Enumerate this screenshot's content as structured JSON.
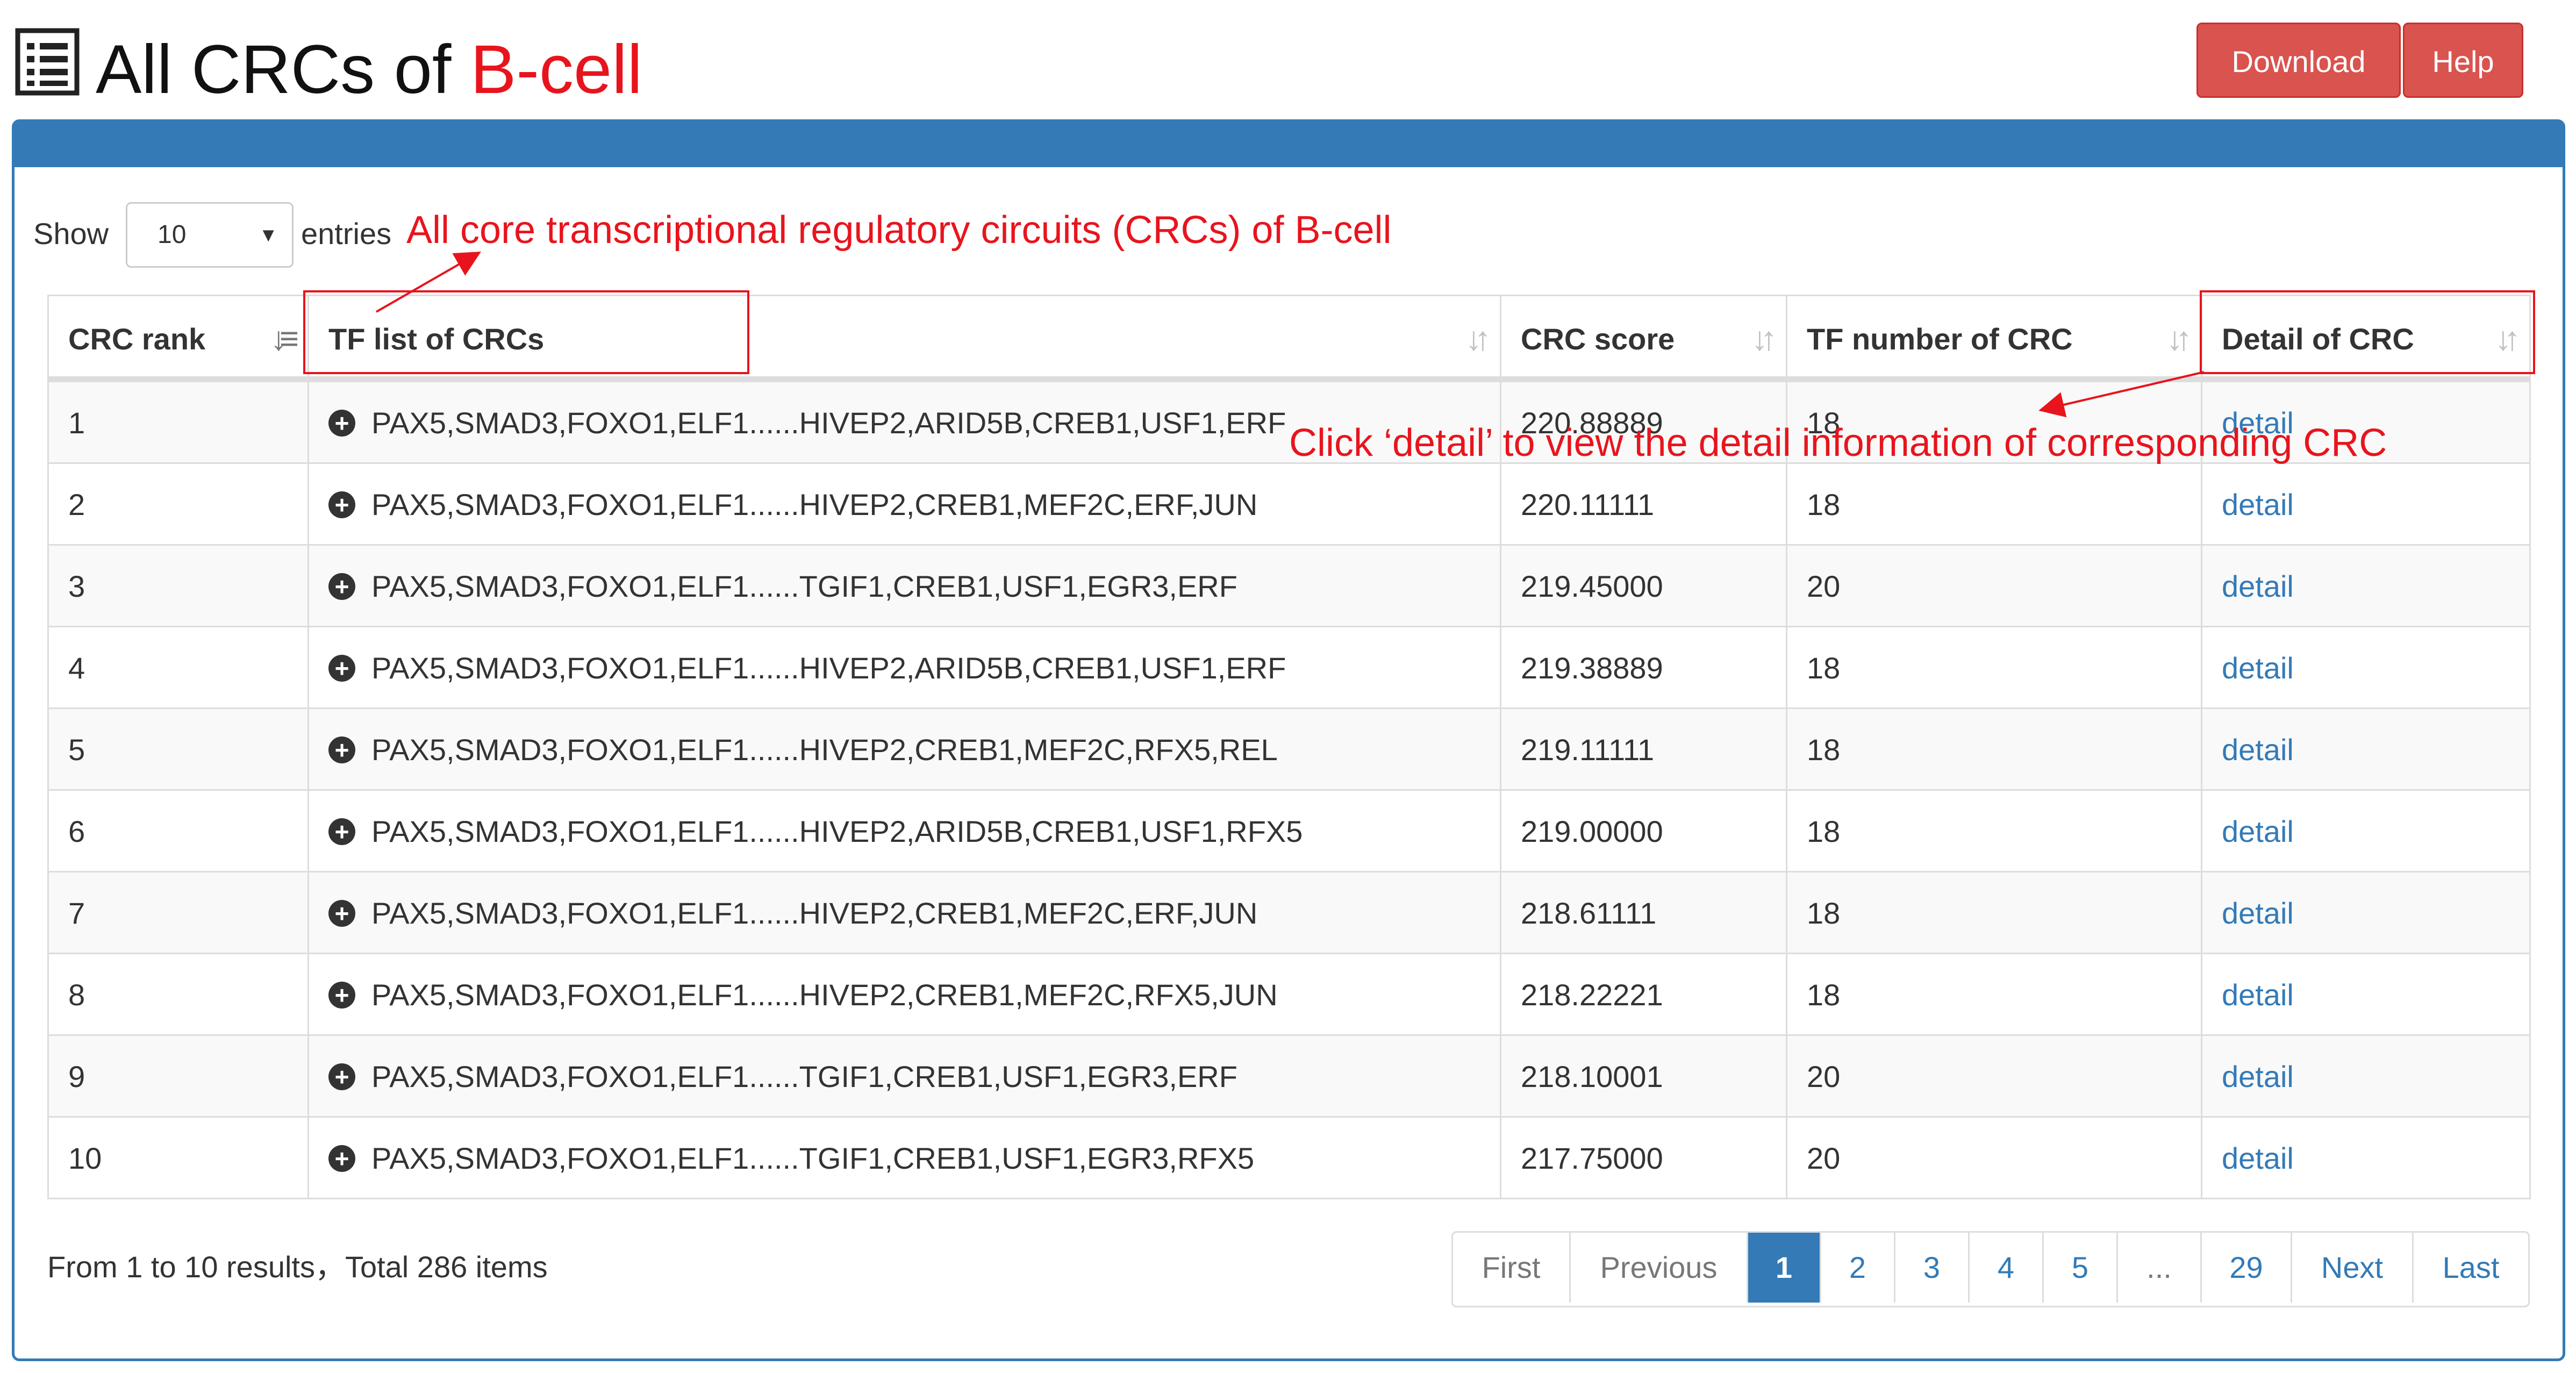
{
  "header": {
    "title_prefix": "All CRCs of ",
    "title_accent": "B-cell",
    "buttons": {
      "download": "Download",
      "help": "Help"
    }
  },
  "controls": {
    "show_label": "Show",
    "page_length": "10",
    "entries_label": "entries"
  },
  "annotations": {
    "table_note": "All core transcriptional regulatory circuits (CRCs) of B-cell",
    "detail_note": "Click ‘detail’ to view the detail information of corresponding CRC"
  },
  "table": {
    "columns": [
      "CRC rank",
      "TF list of CRCs",
      "CRC score",
      "TF number of CRC",
      "Detail of CRC"
    ],
    "rows": [
      {
        "rank": "1",
        "tfs": "PAX5,SMAD3,FOXO1,ELF1......HIVEP2,ARID5B,CREB1,USF1,ERF",
        "score": "220.88889",
        "count": "18",
        "detail": "detail"
      },
      {
        "rank": "2",
        "tfs": "PAX5,SMAD3,FOXO1,ELF1......HIVEP2,CREB1,MEF2C,ERF,JUN",
        "score": "220.11111",
        "count": "18",
        "detail": "detail"
      },
      {
        "rank": "3",
        "tfs": "PAX5,SMAD3,FOXO1,ELF1......TGIF1,CREB1,USF1,EGR3,ERF",
        "score": "219.45000",
        "count": "20",
        "detail": "detail"
      },
      {
        "rank": "4",
        "tfs": "PAX5,SMAD3,FOXO1,ELF1......HIVEP2,ARID5B,CREB1,USF1,ERF",
        "score": "219.38889",
        "count": "18",
        "detail": "detail"
      },
      {
        "rank": "5",
        "tfs": "PAX5,SMAD3,FOXO1,ELF1......HIVEP2,CREB1,MEF2C,RFX5,REL",
        "score": "219.11111",
        "count": "18",
        "detail": "detail"
      },
      {
        "rank": "6",
        "tfs": "PAX5,SMAD3,FOXO1,ELF1......HIVEP2,ARID5B,CREB1,USF1,RFX5",
        "score": "219.00000",
        "count": "18",
        "detail": "detail"
      },
      {
        "rank": "7",
        "tfs": "PAX5,SMAD3,FOXO1,ELF1......HIVEP2,CREB1,MEF2C,ERF,JUN",
        "score": "218.61111",
        "count": "18",
        "detail": "detail"
      },
      {
        "rank": "8",
        "tfs": "PAX5,SMAD3,FOXO1,ELF1......HIVEP2,CREB1,MEF2C,RFX5,JUN",
        "score": "218.22221",
        "count": "18",
        "detail": "detail"
      },
      {
        "rank": "9",
        "tfs": "PAX5,SMAD3,FOXO1,ELF1......TGIF1,CREB1,USF1,EGR3,ERF",
        "score": "218.10001",
        "count": "20",
        "detail": "detail"
      },
      {
        "rank": "10",
        "tfs": "PAX5,SMAD3,FOXO1,ELF1......TGIF1,CREB1,USF1,EGR3,RFX5",
        "score": "217.75000",
        "count": "20",
        "detail": "detail"
      }
    ]
  },
  "footer": {
    "info": "From 1 to 10 results，Total 286 items",
    "pagination": [
      "First",
      "Previous",
      "1",
      "2",
      "3",
      "4",
      "5",
      "...",
      "29",
      "Next",
      "Last"
    ],
    "active_page": "1"
  },
  "colors": {
    "primary": "#337ab7",
    "danger": "#d9534f",
    "annotation": "#e8141d"
  }
}
